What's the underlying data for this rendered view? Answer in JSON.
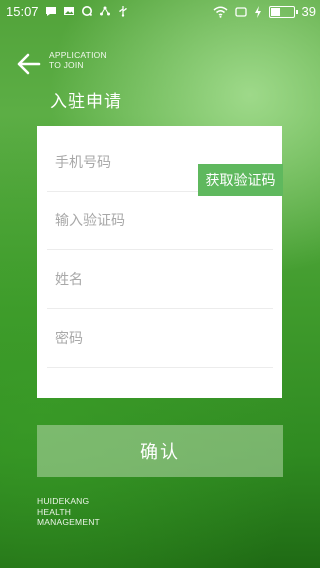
{
  "status_bar": {
    "time": "15:07",
    "left_icons": [
      "chat-bubble-icon",
      "image-icon",
      "sync-icon",
      "share-icon",
      "usb-icon"
    ],
    "right_icons": [
      "wifi-icon",
      "screen-icon",
      "charging-icon",
      "battery-icon"
    ],
    "battery_level": "39"
  },
  "header": {
    "subtitle_line1": "APPLICATION",
    "subtitle_line2": "TO JOIN",
    "title": "入驻申请"
  },
  "form": {
    "phone_placeholder": "手机号码",
    "get_code_label": "获取验证码",
    "code_placeholder": "输入验证码",
    "name_placeholder": "姓名",
    "password_placeholder": "密码"
  },
  "confirm_label": "确认",
  "footer": {
    "line1": "HUIDEKANG",
    "line2": "HEALTH",
    "line3": "MANAGEMENT"
  },
  "colors": {
    "accent_green": "#5fb85e",
    "background_green": "#3f9a2c",
    "confirm_button": "#a9cf9c"
  }
}
